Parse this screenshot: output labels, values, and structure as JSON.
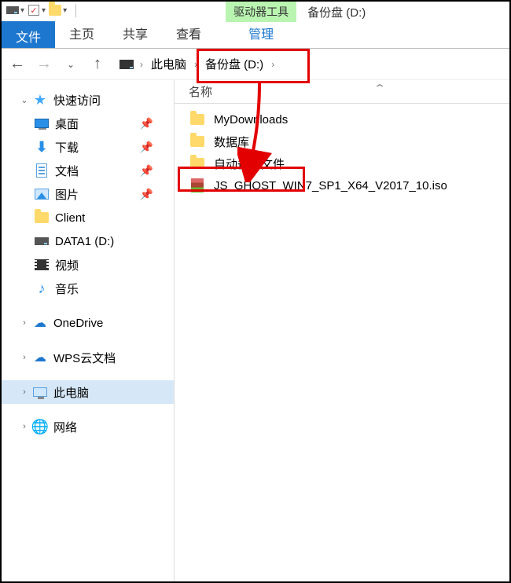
{
  "titlebar": {
    "context_tab": "驱动器工具",
    "window_title": "备份盘 (D:)"
  },
  "ribbon": {
    "file": "文件",
    "home": "主页",
    "share": "共享",
    "view": "查看",
    "manage": "管理"
  },
  "addressbar": {
    "this_pc": "此电脑",
    "drive": "备份盘 (D:)"
  },
  "columns": {
    "name": "名称"
  },
  "sidebar": {
    "quick_access": "快速访问",
    "desktop": "桌面",
    "downloads": "下载",
    "documents": "文档",
    "pictures": "图片",
    "client": "Client",
    "data1": "DATA1 (D:)",
    "videos": "视频",
    "music": "音乐",
    "onedrive": "OneDrive",
    "wps": "WPS云文档",
    "this_pc": "此电脑",
    "network": "网络"
  },
  "files": [
    {
      "icon": "folder",
      "name": "MyDownloads"
    },
    {
      "icon": "folder",
      "name": "数据库"
    },
    {
      "icon": "folder",
      "name": "自动备份文件"
    },
    {
      "icon": "rar",
      "name": "JS_GHOST_WIN7_SP1_X64_V2017_10.iso"
    }
  ]
}
